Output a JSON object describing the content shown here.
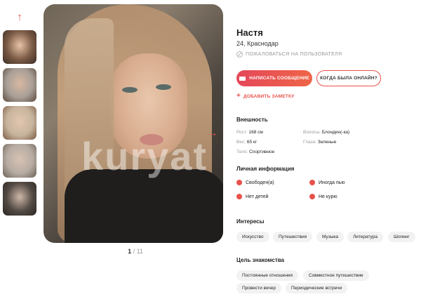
{
  "gallery": {
    "thumbnails": [
      {
        "colors": [
          "#7a5a45",
          "#e8c3a7",
          "#3c2d24"
        ]
      },
      {
        "colors": [
          "#a89f97",
          "#d9b8a1",
          "#5d4a3d"
        ]
      },
      {
        "colors": [
          "#c7b49e",
          "#e2c6ae",
          "#7d5a44"
        ]
      },
      {
        "colors": [
          "#b7aca3",
          "#d7c2b3",
          "#6c6157"
        ]
      },
      {
        "colors": [
          "#524a44",
          "#cfb7a7",
          "#2a2522"
        ]
      }
    ],
    "watermark": "kuryat",
    "current": "1",
    "total": "/ 11"
  },
  "profile": {
    "name": "Настя",
    "age_city": "24, Краснодар",
    "complain_label": "ПОЖАЛОВАТЬСЯ НА ПОЛЬЗОВАТЕЛЯ",
    "message_button": "НАПИСАТЬ СООБЩЕНИЕ",
    "online_button": "КОГДА БЫЛА ОНЛАЙН?",
    "add_note": "ДОБАВИТЬ ЗАМЕТКУ"
  },
  "appearance": {
    "title": "Внешность",
    "height_label": "Рост:",
    "height_value": "168 см",
    "hair_label": "Волосы:",
    "hair_value": "Блондин(-ка)",
    "weight_label": "Вес:",
    "weight_value": "65 кг",
    "eyes_label": "Глаза:",
    "eyes_value": "Зеленые",
    "body_label": "Тело:",
    "body_value": "Спортивное"
  },
  "personal": {
    "title": "Личная информация",
    "items": [
      {
        "text": "Свободен(а)",
        "icon": "heart-icon"
      },
      {
        "text": "Иногда пью",
        "icon": "wine-icon"
      },
      {
        "text": "Нет детей",
        "icon": "stroller-icon"
      },
      {
        "text": "Не курю",
        "icon": "no-smoking-icon"
      }
    ]
  },
  "interests": {
    "title": "Интересы",
    "tags": [
      "Искусство",
      "Путешествия",
      "Музыка",
      "Литература",
      "Шопинг"
    ]
  },
  "goal": {
    "title": "Цель знакомства",
    "tags": [
      "Постоянные отношения",
      "Совместное путешествие",
      "Провести вечер",
      "Периодические встречи"
    ]
  },
  "colors": {
    "accent": "#e8514a",
    "chip_bg": "#f2f2f2"
  }
}
